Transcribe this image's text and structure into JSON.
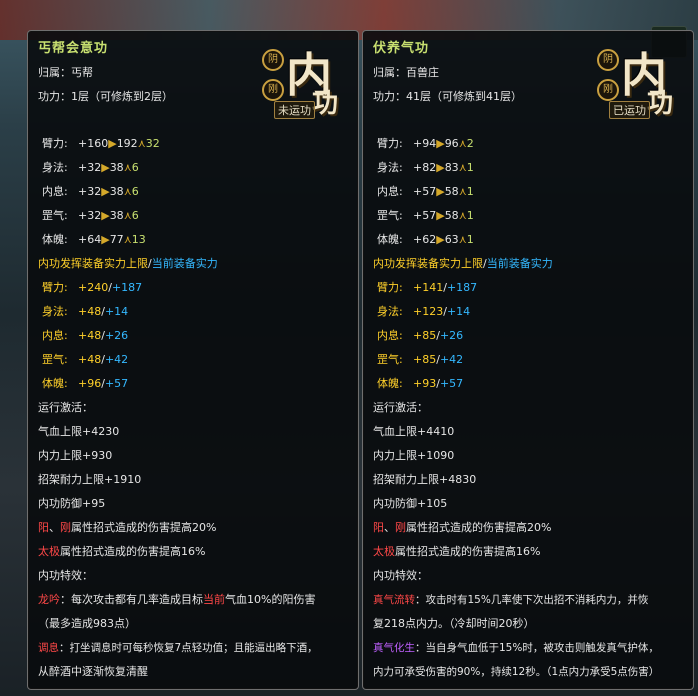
{
  "left": {
    "title": "丐帮会意功",
    "belong_label": "归属：",
    "belong_value": "丐帮",
    "level_label": "功力：",
    "level_value": "1层（可修炼到2层）",
    "badge": {
      "top_char": "阴",
      "mid_char": "刚",
      "big": "内",
      "gong": "功",
      "status": "未运功"
    },
    "base_stats": [
      {
        "label": "臂力:",
        "base": "+160",
        "max": "192",
        "inc": "32"
      },
      {
        "label": "身法:",
        "base": "+32",
        "max": "38",
        "inc": "6"
      },
      {
        "label": "内息:",
        "base": "+32",
        "max": "38",
        "inc": "6"
      },
      {
        "label": "罡气:",
        "base": "+32",
        "max": "38",
        "inc": "6"
      },
      {
        "label": "体魄:",
        "base": "+64",
        "max": "77",
        "inc": "13"
      }
    ],
    "equip_header_a": "内功发挥装备实力上限",
    "equip_header_sep": "/",
    "equip_header_b": "当前装备实力",
    "equip_stats": [
      {
        "label": "臂力:",
        "a": "+240",
        "b": "+187"
      },
      {
        "label": "身法:",
        "a": "+48",
        "b": "+14"
      },
      {
        "label": "内息:",
        "a": "+48",
        "b": "+26"
      },
      {
        "label": "罡气:",
        "a": "+48",
        "b": "+42"
      },
      {
        "label": "体魄:",
        "a": "+96",
        "b": "+57"
      }
    ],
    "activate_header": "运行激活：",
    "activate": [
      "气血上限+4230",
      "内力上限+930",
      "招架耐力上限+1910",
      "内功防御+95"
    ],
    "bonus1_a": "阳",
    "bonus1_sep": "、",
    "bonus1_b": "刚",
    "bonus1_rest": "属性招式造成的伤害提高20%",
    "bonus2_a": "太极",
    "bonus2_rest": "属性招式造成的伤害提高16%",
    "special_header": "内功特效：",
    "special1_name": "龙吟",
    "special1_text_a": "：每次攻击都有几率造成目标",
    "special1_highlight": "当前",
    "special1_text_b": "气血10%的阳伤害",
    "special1_line2": "（最多造成983点）",
    "special2_name": "调息",
    "special2_text": "：打坐调息时可每秒恢复7点轻功值；且能逼出略下酒，",
    "special2_line2": "从醉酒中逐渐恢复清醒"
  },
  "right": {
    "title": "伏养气功",
    "belong_label": "归属：",
    "belong_value": "百兽庄",
    "level_label": "功力：",
    "level_value": "41层（可修炼到41层）",
    "badge": {
      "top_char": "阴",
      "mid_char": "刚",
      "big": "内",
      "gong": "功",
      "status": "已运功"
    },
    "base_stats": [
      {
        "label": "臂力:",
        "base": "+94",
        "max": "96",
        "inc": "2"
      },
      {
        "label": "身法:",
        "base": "+82",
        "max": "83",
        "inc": "1"
      },
      {
        "label": "内息:",
        "base": "+57",
        "max": "58",
        "inc": "1"
      },
      {
        "label": "罡气:",
        "base": "+57",
        "max": "58",
        "inc": "1"
      },
      {
        "label": "体魄:",
        "base": "+62",
        "max": "63",
        "inc": "1"
      }
    ],
    "equip_header_a": "内功发挥装备实力上限",
    "equip_header_sep": "/",
    "equip_header_b": "当前装备实力",
    "equip_stats": [
      {
        "label": "臂力:",
        "a": "+141",
        "b": "+187"
      },
      {
        "label": "身法:",
        "a": "+123",
        "b": "+14"
      },
      {
        "label": "内息:",
        "a": "+85",
        "b": "+26"
      },
      {
        "label": "罡气:",
        "a": "+85",
        "b": "+42"
      },
      {
        "label": "体魄:",
        "a": "+93",
        "b": "+57"
      }
    ],
    "activate_header": "运行激活：",
    "activate": [
      "气血上限+4410",
      "内力上限+1090",
      "招架耐力上限+4830",
      "内功防御+105"
    ],
    "bonus1_a": "阳",
    "bonus1_sep": "、",
    "bonus1_b": "刚",
    "bonus1_rest": "属性招式造成的伤害提高20%",
    "bonus2_a": "太极",
    "bonus2_rest": "属性招式造成的伤害提高16%",
    "special_header": "内功特效：",
    "special1_name": "真气流转",
    "special1_text": "：攻击时有15%几率使下次出招不消耗内力，并恢",
    "special1_line2": "复218点内力。（冷却时间20秒）",
    "special2_name": "真气化生",
    "special2_text": "：当自身气血低于15%时，被攻击则触发真气护体，",
    "special2_line2": "内力可承受伤害的90%，持续12秒。（1点内力承受5点伤害）"
  },
  "colors": {
    "title": "#c8e070",
    "yellow": "#ffd02a",
    "blue": "#34b8ff",
    "red": "#ff4848",
    "purple": "#c060ff"
  },
  "icons": {
    "arrow": "▶",
    "up": "⋏"
  }
}
